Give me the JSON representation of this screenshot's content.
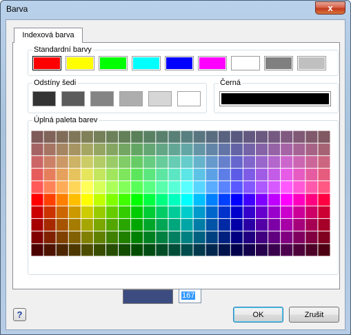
{
  "window": {
    "title": "Barva",
    "close_label": "x"
  },
  "tabs": [
    {
      "label": "Indexová barva"
    }
  ],
  "standard": {
    "label": "Standardní barvy",
    "colors": [
      "#ff0000",
      "#ffff00",
      "#00ff00",
      "#00ffff",
      "#0000ff",
      "#ff00ff",
      "#ffffff",
      "#808080",
      "#c0c0c0"
    ]
  },
  "grays": {
    "label": "Odstíny šedi",
    "colors": [
      "#333333",
      "#5b5b5b",
      "#848484",
      "#adadad",
      "#d6d6d6",
      "#ffffff"
    ]
  },
  "black": {
    "label": "Černá",
    "color": "#000000"
  },
  "palette": {
    "label": "Úplná paleta barev",
    "columns": 24,
    "rows": 10
  },
  "current": {
    "preview_color": "#3c4c80",
    "index_value": "167"
  },
  "buttons": {
    "help": "?",
    "ok": "OK",
    "cancel": "Zrušit"
  }
}
